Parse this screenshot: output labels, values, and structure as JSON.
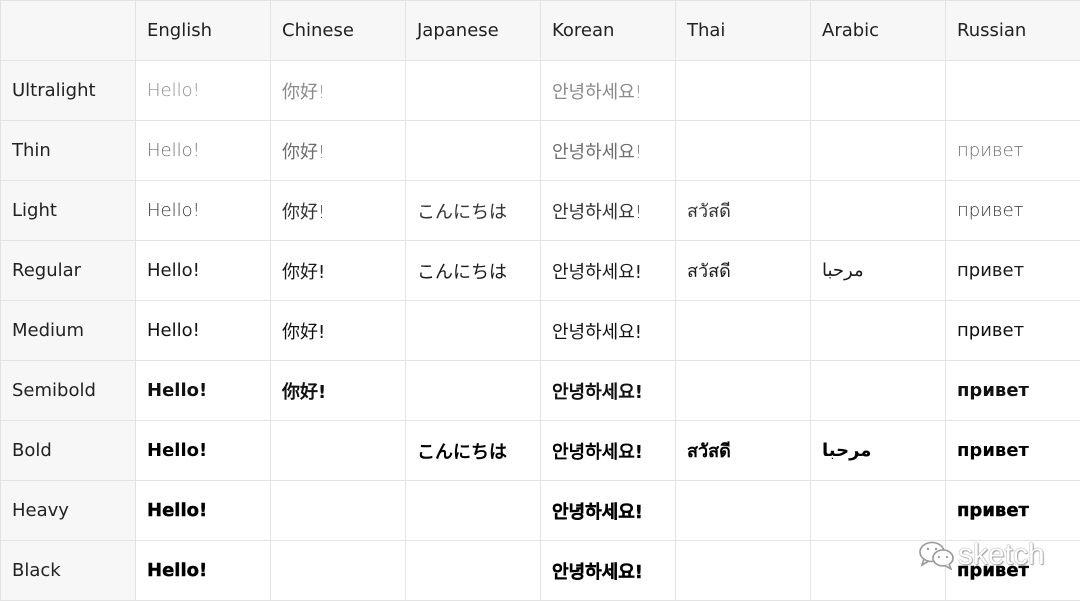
{
  "table": {
    "corner": "",
    "columns": [
      "English",
      "Chinese",
      "Japanese",
      "Korean",
      "Thai",
      "Arabic",
      "Russian"
    ],
    "rows": [
      {
        "weight": "Ultralight",
        "cells": [
          "Hello!",
          "你好!",
          "",
          "안녕하세요!",
          "",
          "",
          ""
        ]
      },
      {
        "weight": "Thin",
        "cells": [
          "Hello!",
          "你好!",
          "",
          "안녕하세요!",
          "",
          "",
          "привет"
        ]
      },
      {
        "weight": "Light",
        "cells": [
          "Hello!",
          "你好!",
          "こんにちは",
          "안녕하세요!",
          "สวัสดี",
          "",
          "привет"
        ]
      },
      {
        "weight": "Regular",
        "cells": [
          "Hello!",
          "你好!",
          "こんにちは",
          "안녕하세요!",
          "สวัสดี",
          "مرحبا",
          "привет"
        ]
      },
      {
        "weight": "Medium",
        "cells": [
          "Hello!",
          "你好!",
          "",
          "안녕하세요!",
          "",
          "",
          "привет"
        ]
      },
      {
        "weight": "Semibold",
        "cells": [
          "Hello!",
          "你好!",
          "",
          "안녕하세요!",
          "",
          "",
          "привет"
        ]
      },
      {
        "weight": "Bold",
        "cells": [
          "Hello!",
          "",
          "こんにちは",
          "안녕하세요!",
          "สวัสดี",
          "مرحبا",
          "привет"
        ]
      },
      {
        "weight": "Heavy",
        "cells": [
          "Hello!",
          "",
          "",
          "안녕하세요!",
          "",
          "",
          "привет"
        ]
      },
      {
        "weight": "Black",
        "cells": [
          "Hello!",
          "",
          "",
          "안녕하세요!",
          "",
          "",
          "привет"
        ]
      }
    ]
  },
  "watermark": {
    "icon": "wechat-icon",
    "text": "sketch"
  },
  "colors": {
    "header_bg": "#f7f7f7",
    "border": "#e3e3e3",
    "text": "#1a1a1a"
  }
}
